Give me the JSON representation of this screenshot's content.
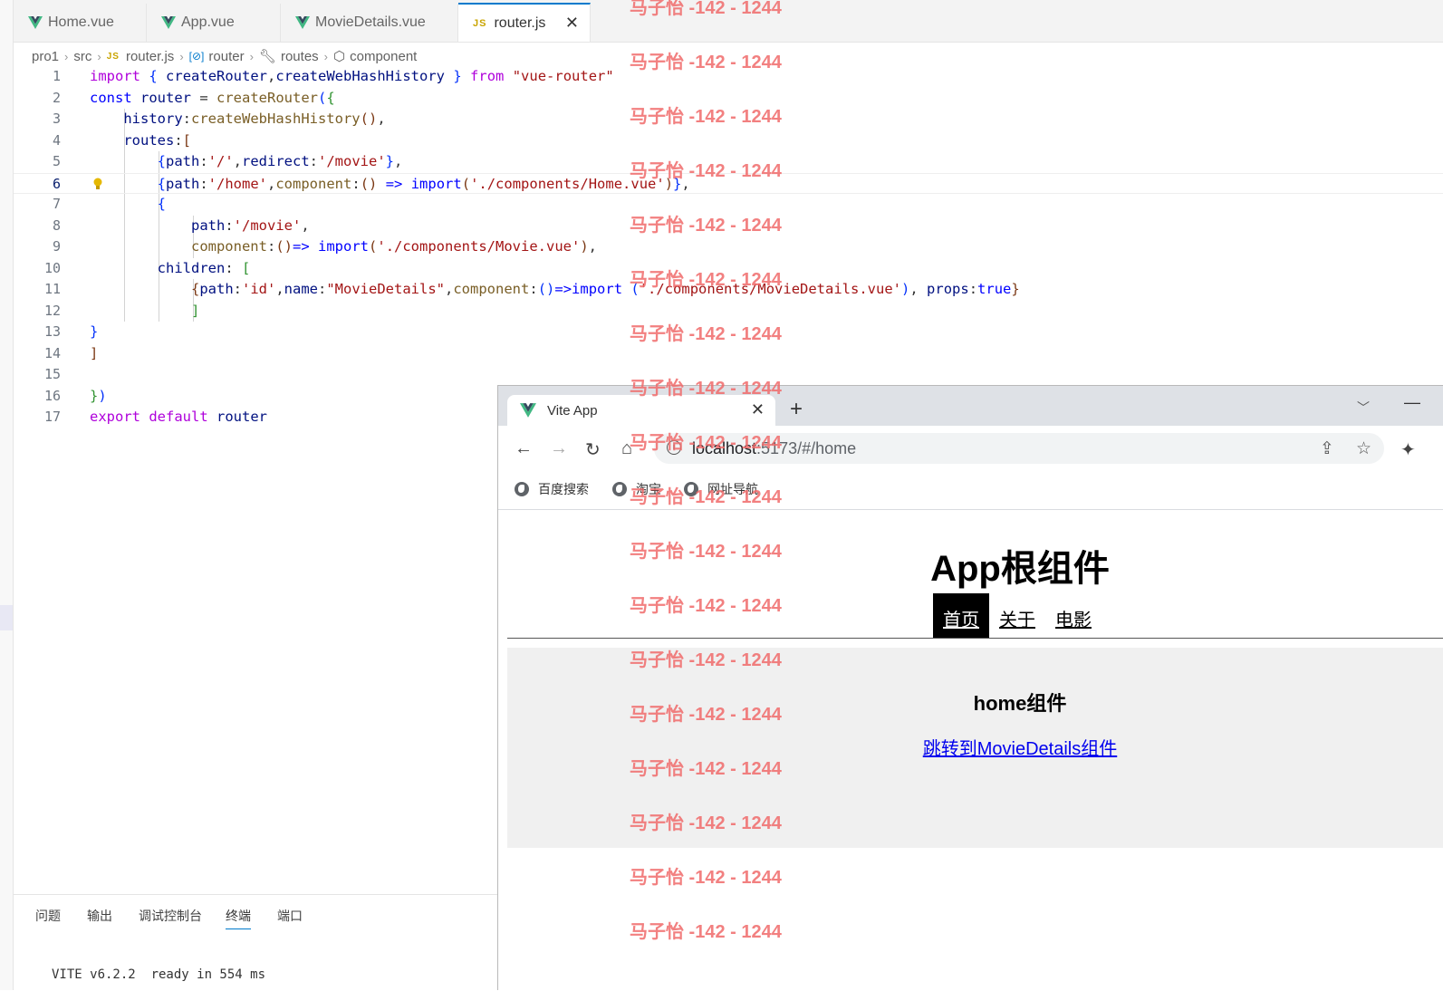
{
  "editor": {
    "tabs": [
      {
        "name": "Home.vue",
        "type": "vue"
      },
      {
        "name": "App.vue",
        "type": "vue"
      },
      {
        "name": "MovieDetails.vue",
        "type": "vue"
      },
      {
        "name": "router.js",
        "type": "js",
        "active": true
      }
    ],
    "breadcrumb": [
      "pro1",
      "src",
      "router.js",
      "router",
      "routes",
      "component"
    ],
    "js_badge": "JS",
    "lines": [
      {
        "n": "1",
        "tokens": [
          [
            "kw",
            "import"
          ],
          [
            "pc",
            " "
          ],
          [
            "br1",
            "{"
          ],
          [
            "pc",
            " "
          ],
          [
            "vr",
            "createRouter"
          ],
          [
            "pc",
            ","
          ],
          [
            "vr",
            "createWebHashHistory"
          ],
          [
            "pc",
            " "
          ],
          [
            "br1",
            "}"
          ],
          [
            "pc",
            " "
          ],
          [
            "kw",
            "from"
          ],
          [
            "pc",
            " "
          ],
          [
            "st",
            "\"vue-router\""
          ]
        ]
      },
      {
        "n": "2",
        "tokens": [
          [
            "kb",
            "const"
          ],
          [
            "pc",
            " "
          ],
          [
            "vr",
            "router"
          ],
          [
            "pc",
            " = "
          ],
          [
            "fn",
            "createRouter"
          ],
          [
            "br1",
            "("
          ],
          [
            "br2",
            "{"
          ]
        ]
      },
      {
        "n": "3",
        "tokens": [
          [
            "pc",
            "    "
          ],
          [
            "vr",
            "history"
          ],
          [
            "pc",
            ":"
          ],
          [
            "fn",
            "createWebHashHistory"
          ],
          [
            "br3",
            "()"
          ],
          [
            "pc",
            ","
          ]
        ]
      },
      {
        "n": "4",
        "tokens": [
          [
            "pc",
            "    "
          ],
          [
            "vr",
            "routes"
          ],
          [
            "pc",
            ":"
          ],
          [
            "br3",
            "["
          ]
        ]
      },
      {
        "n": "5",
        "tokens": [
          [
            "pc",
            "        "
          ],
          [
            "br1",
            "{"
          ],
          [
            "vr",
            "path"
          ],
          [
            "pc",
            ":"
          ],
          [
            "st",
            "'/'"
          ],
          [
            "pc",
            ","
          ],
          [
            "vr",
            "redirect"
          ],
          [
            "pc",
            ":"
          ],
          [
            "st",
            "'/movie'"
          ],
          [
            "br1",
            "}"
          ],
          [
            "pc",
            ","
          ]
        ]
      },
      {
        "n": "6",
        "cur": true,
        "tokens": [
          [
            "pc",
            "        "
          ],
          [
            "br1",
            "{"
          ],
          [
            "vr",
            "path"
          ],
          [
            "pc",
            ":"
          ],
          [
            "st",
            "'/home'"
          ],
          [
            "pc",
            ","
          ],
          [
            "fn",
            "component"
          ],
          [
            "pc",
            ":"
          ],
          [
            "br3",
            "()"
          ],
          [
            "pc",
            " "
          ],
          [
            "kb",
            "=>"
          ],
          [
            "pc",
            " "
          ],
          [
            "kb",
            "import"
          ],
          [
            "br3",
            "("
          ],
          [
            "st",
            "'./components/Home.vue'"
          ],
          [
            "br3",
            ")"
          ],
          [
            "br1",
            "}"
          ],
          [
            "pc",
            ","
          ]
        ]
      },
      {
        "n": "7",
        "tokens": [
          [
            "pc",
            "        "
          ],
          [
            "br1",
            "{"
          ]
        ]
      },
      {
        "n": "8",
        "tokens": [
          [
            "pc",
            "            "
          ],
          [
            "vr",
            "path"
          ],
          [
            "pc",
            ":"
          ],
          [
            "st",
            "'/movie'"
          ],
          [
            "pc",
            ","
          ]
        ]
      },
      {
        "n": "9",
        "tokens": [
          [
            "pc",
            "            "
          ],
          [
            "fn",
            "component"
          ],
          [
            "pc",
            ":"
          ],
          [
            "br3",
            "()"
          ],
          [
            "kb",
            "=>"
          ],
          [
            "pc",
            " "
          ],
          [
            "kb",
            "import"
          ],
          [
            "br3",
            "("
          ],
          [
            "st",
            "'./components/Movie.vue'"
          ],
          [
            "br3",
            ")"
          ],
          [
            "pc",
            ","
          ]
        ]
      },
      {
        "n": "10",
        "tokens": [
          [
            "pc",
            "        "
          ],
          [
            "vr",
            "children"
          ],
          [
            "pc",
            ": "
          ],
          [
            "br2",
            "["
          ]
        ]
      },
      {
        "n": "11",
        "tokens": [
          [
            "pc",
            "            "
          ],
          [
            "br3",
            "{"
          ],
          [
            "vr",
            "path"
          ],
          [
            "pc",
            ":"
          ],
          [
            "st",
            "'id'"
          ],
          [
            "pc",
            ","
          ],
          [
            "vr",
            "name"
          ],
          [
            "pc",
            ":"
          ],
          [
            "st",
            "\"MovieDetails\""
          ],
          [
            "pc",
            ","
          ],
          [
            "fn",
            "component"
          ],
          [
            "pc",
            ":"
          ],
          [
            "br1",
            "()"
          ],
          [
            "kb",
            "=>"
          ],
          [
            "kb",
            "import"
          ],
          [
            "pc",
            " "
          ],
          [
            "br1",
            "("
          ],
          [
            "st",
            "'./components/MovieDetails.vue'"
          ],
          [
            "br1",
            ")"
          ],
          [
            "pc",
            ", "
          ],
          [
            "vr",
            "props"
          ],
          [
            "pc",
            ":"
          ],
          [
            "kb",
            "true"
          ],
          [
            "br3",
            "}"
          ]
        ]
      },
      {
        "n": "12",
        "tokens": [
          [
            "pc",
            "            "
          ],
          [
            "br2",
            "]"
          ]
        ]
      },
      {
        "n": "13",
        "tokens": [
          [
            "br1",
            "}"
          ]
        ]
      },
      {
        "n": "14",
        "tokens": [
          [
            "br3",
            "]"
          ]
        ]
      },
      {
        "n": "15",
        "tokens": []
      },
      {
        "n": "16",
        "tokens": [
          [
            "br2",
            "}"
          ],
          [
            "br1",
            ")"
          ]
        ]
      },
      {
        "n": "17",
        "tokens": [
          [
            "kw",
            "export"
          ],
          [
            "pc",
            " "
          ],
          [
            "kw",
            "default"
          ],
          [
            "pc",
            " "
          ],
          [
            "vr",
            "router"
          ]
        ]
      }
    ]
  },
  "panel": {
    "tabs": [
      "问题",
      "输出",
      "调试控制台",
      "终端",
      "端口"
    ],
    "active_tab": "终端",
    "terminal_text": "VITE v6.2.2  ready in 554 ms"
  },
  "browser": {
    "tab_title": "Vite App",
    "url_host": "localhost",
    "url_rest": ":5173/#/home",
    "bookmarks": [
      "百度搜索",
      "淘宝",
      "网址导航"
    ],
    "page": {
      "app_title": "App根组件",
      "nav": [
        "首页",
        "关于",
        "电影"
      ],
      "active_nav": "首页",
      "home_title": "home组件",
      "home_link": "跳转到MovieDetails组件"
    }
  },
  "watermark": "马子怡 -142 - 1244",
  "colors": {
    "accent": "#007acc",
    "string": "#a31515",
    "keyword": "#af00db",
    "watermark": "#f06b6b"
  }
}
